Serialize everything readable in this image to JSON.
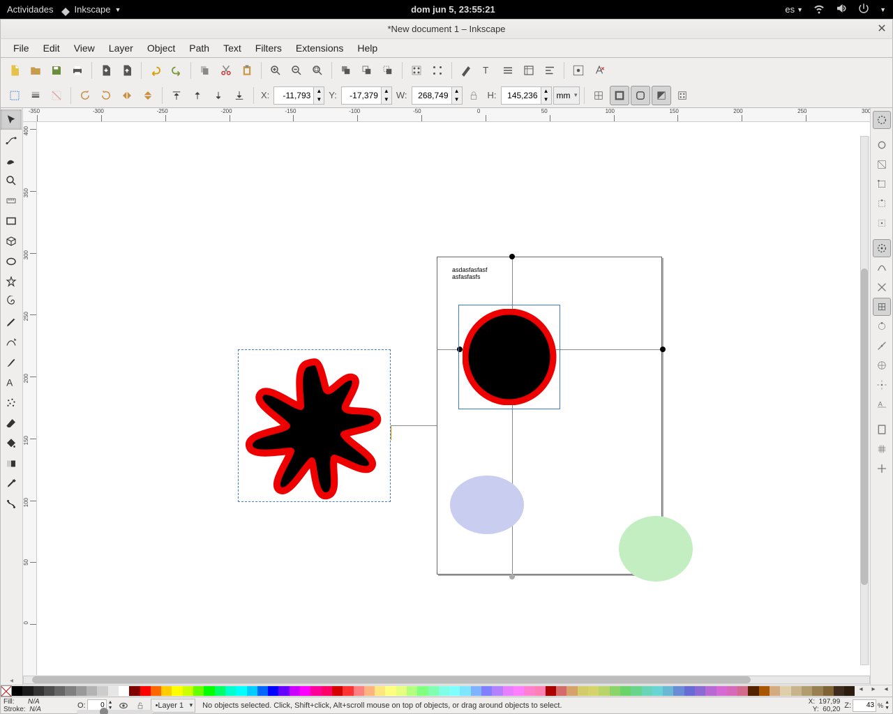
{
  "gnome": {
    "activities": "Actividades",
    "app": "Inkscape",
    "clock": "dom jun  5, 23:55:21",
    "lang": "es"
  },
  "window": {
    "title": "*New document 1 – Inkscape"
  },
  "menu": {
    "file": "File",
    "edit": "Edit",
    "view": "View",
    "layer": "Layer",
    "object": "Object",
    "path": "Path",
    "text": "Text",
    "filters": "Filters",
    "extensions": "Extensions",
    "help": "Help"
  },
  "coords": {
    "x_label": "X:",
    "x": "-11,793",
    "y_label": "Y:",
    "y": "-17,379",
    "w_label": "W:",
    "w": "268,749",
    "h_label": "H:",
    "h": "145,236",
    "unit": "mm"
  },
  "canvas_text": {
    "line1": "asdasfasfasf",
    "line2": "asfasfasfs"
  },
  "status": {
    "fill_label": "Fill:",
    "fill": "N/A",
    "stroke_label": "Stroke:",
    "stroke": "N/A",
    "o_label": "O:",
    "opacity": "0",
    "layer": "•Layer 1",
    "hint": "No objects selected. Click, Shift+click, Alt+scroll mouse on top of objects, or drag around objects to select.",
    "cx_label": "X:",
    "cx": "197,99",
    "cy_label": "Y:",
    "cy": "60,20",
    "z_label": "Z:",
    "zoom": "43",
    "zoom_suffix": "%"
  },
  "ruler_h": [
    "-350",
    "-300",
    "-250",
    "-200",
    "-150",
    "-100",
    "-50",
    "0",
    "50",
    "100",
    "150",
    "200",
    "250",
    "300"
  ],
  "ruler_v": [
    "400",
    "350",
    "300",
    "250",
    "200",
    "150",
    "100",
    "50",
    "0"
  ],
  "palette": [
    "#000000",
    "#1a1a1a",
    "#333333",
    "#4d4d4d",
    "#666666",
    "#808080",
    "#999999",
    "#b3b3b3",
    "#cccccc",
    "#e6e6e6",
    "#ffffff",
    "#800000",
    "#ff0000",
    "#ff6600",
    "#ffcc00",
    "#ffff00",
    "#ccff00",
    "#66ff00",
    "#00ff00",
    "#00ff66",
    "#00ffcc",
    "#00ffff",
    "#00ccff",
    "#0066ff",
    "#0000ff",
    "#6600ff",
    "#cc00ff",
    "#ff00ff",
    "#ff0099",
    "#ff0066",
    "#d40000",
    "#ff3333",
    "#ff8080",
    "#ffb380",
    "#ffe680",
    "#ffff80",
    "#e6ff80",
    "#b3ff80",
    "#80ff80",
    "#80ffb3",
    "#80ffe6",
    "#80ffff",
    "#80e6ff",
    "#80b3ff",
    "#8080ff",
    "#b380ff",
    "#e680ff",
    "#ff80ff",
    "#ff80cc",
    "#ff80b3",
    "#aa0000",
    "#d46a6a",
    "#d4a26a",
    "#d4cc6a",
    "#d4d46a",
    "#b8d46a",
    "#8cd46a",
    "#6ad46a",
    "#6ad48c",
    "#6ad4b8",
    "#6ad4d4",
    "#6ab8d4",
    "#6a8cd4",
    "#6a6ad4",
    "#8c6ad4",
    "#b86ad4",
    "#d46ad4",
    "#d46ab8",
    "#d46a8c",
    "#552200",
    "#aa5500",
    "#d4aa80",
    "#e0cda9",
    "#c8b48c",
    "#b09c6f",
    "#987f52",
    "#806335",
    "#3d2b1f",
    "#2b1d0e"
  ]
}
